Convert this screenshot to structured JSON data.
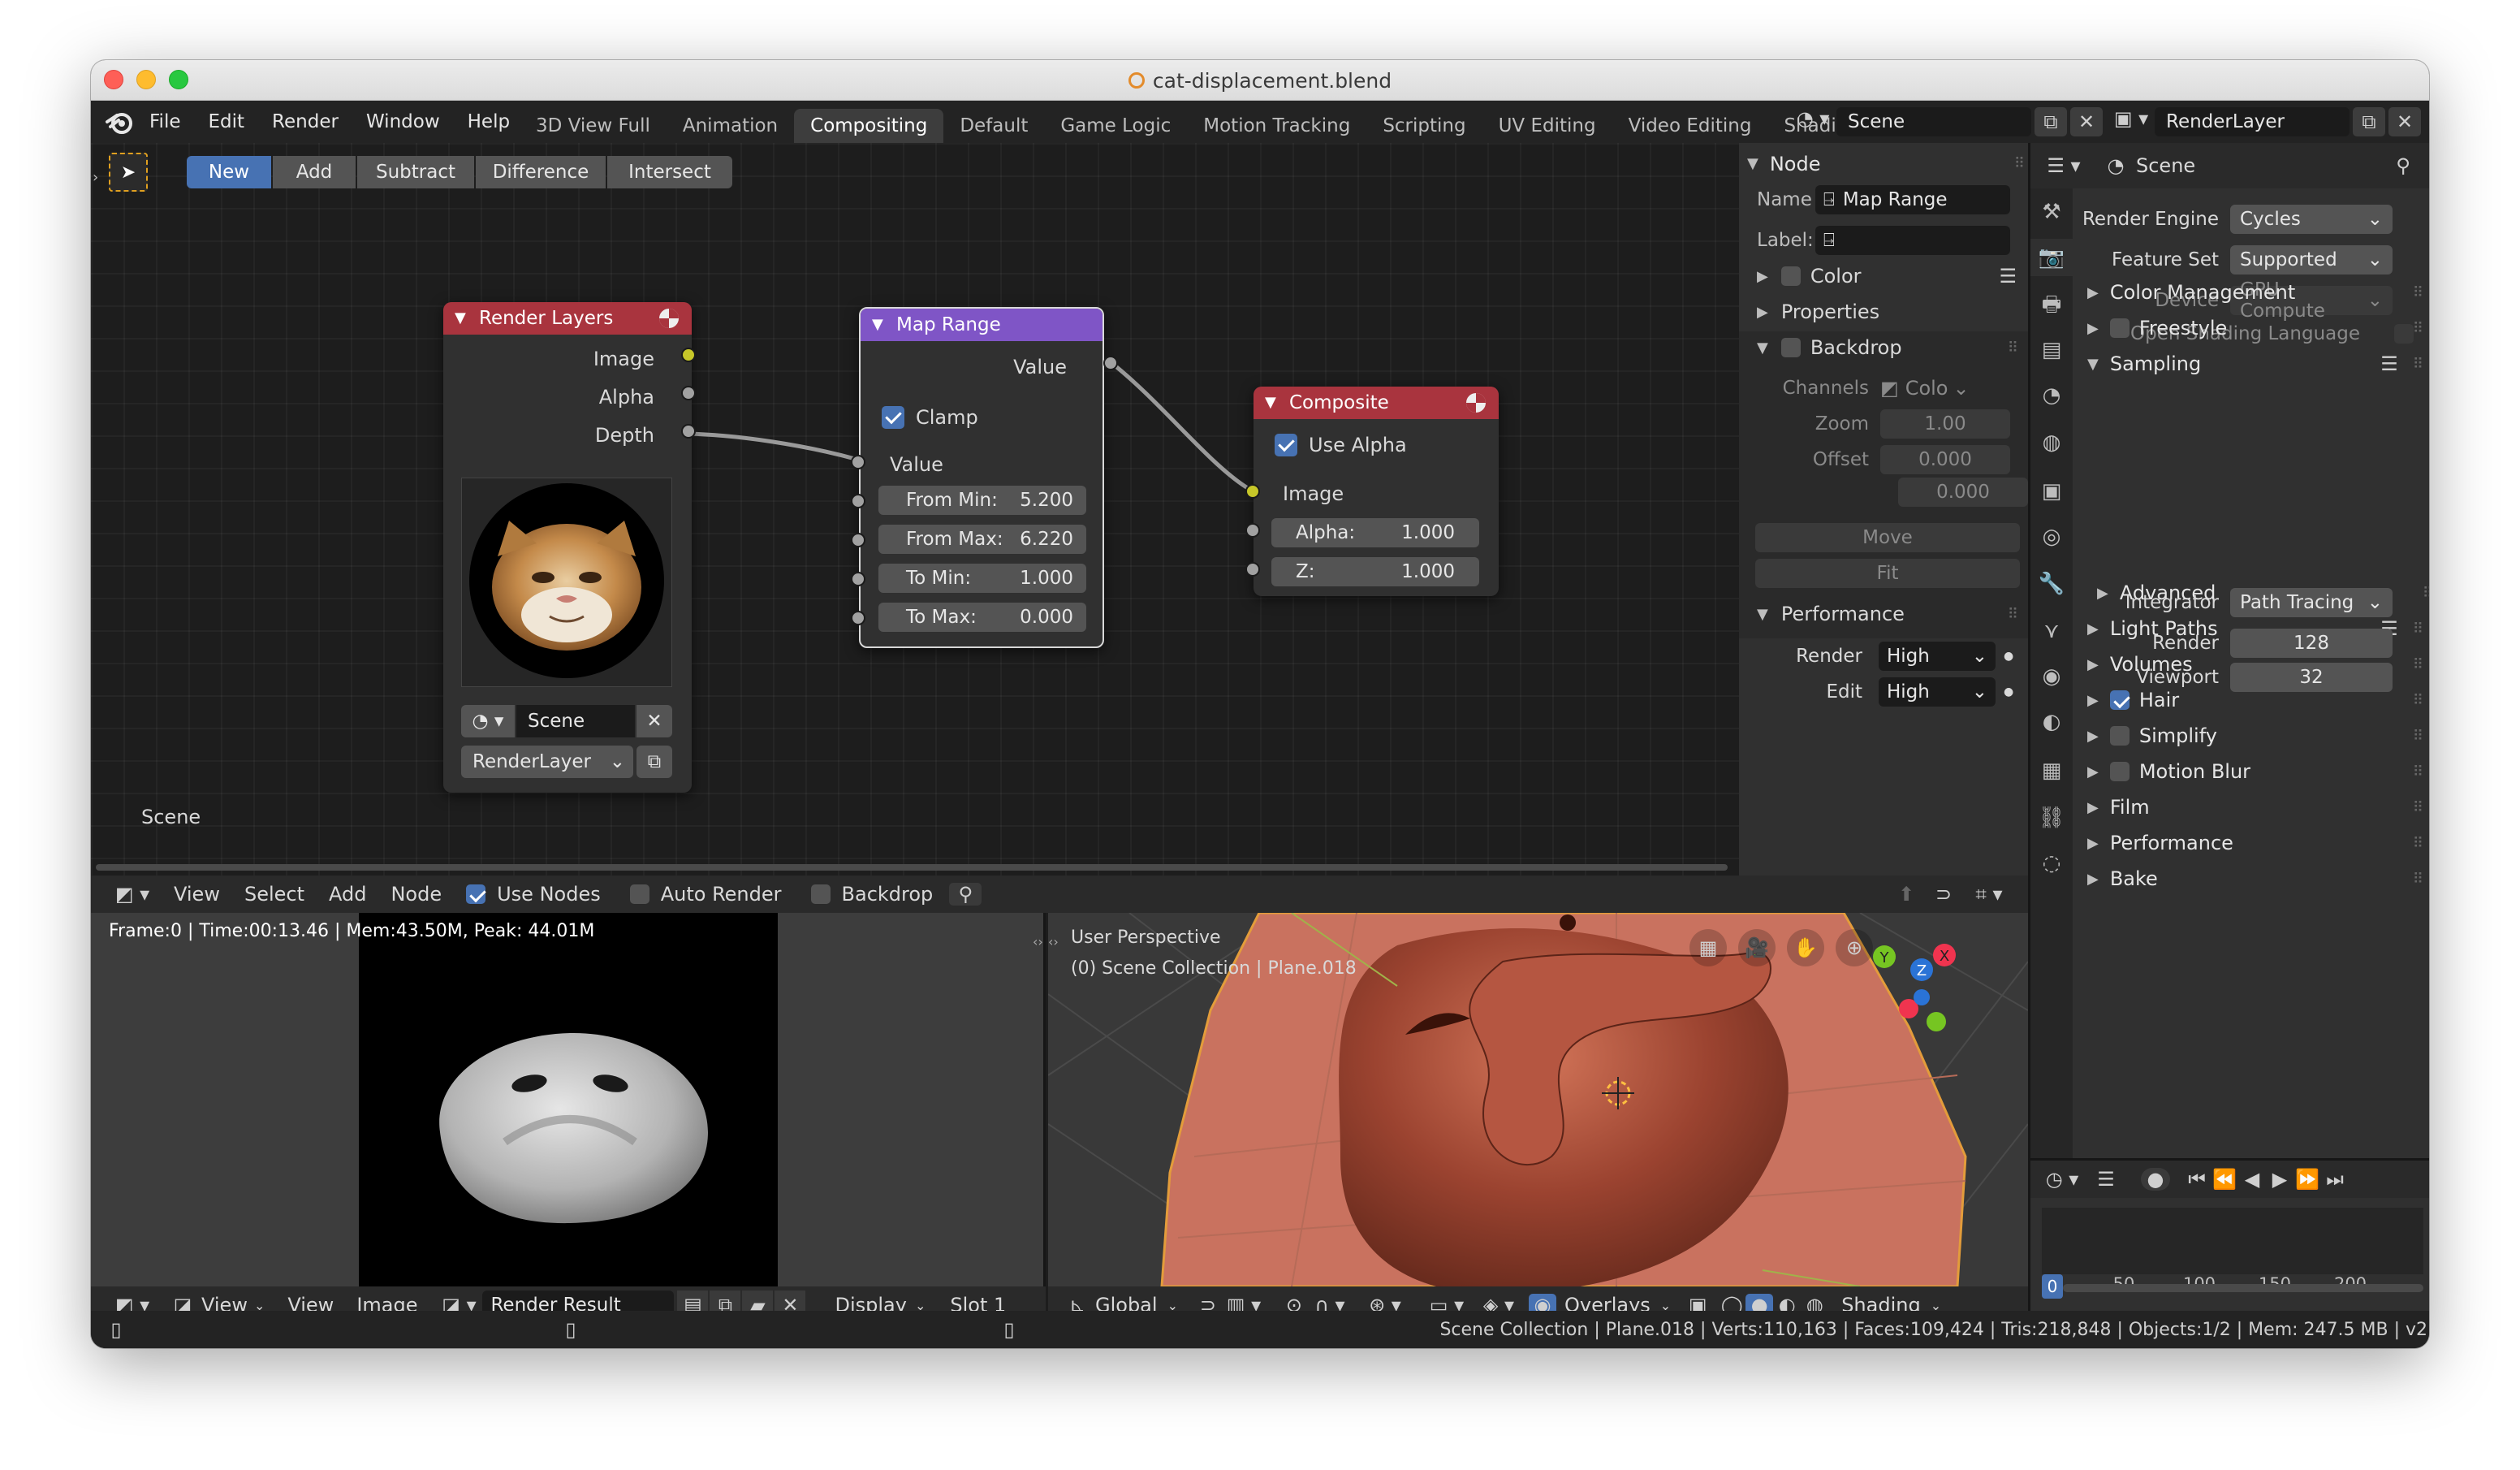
{
  "window": {
    "title": "cat-displacement.blend"
  },
  "menu": {
    "items": [
      "File",
      "Edit",
      "Render",
      "Window",
      "Help"
    ]
  },
  "workspaces": {
    "tabs": [
      "3D View Full",
      "Animation",
      "Compositing",
      "Default",
      "Game Logic",
      "Motion Tracking",
      "Scripting",
      "UV Editing",
      "Video Editing",
      "Shading"
    ],
    "active": "Compositing"
  },
  "scene_selector": {
    "value": "Scene"
  },
  "layer_selector": {
    "value": "RenderLayer"
  },
  "toolbar": {
    "new": "New",
    "add": "Add",
    "subtract": "Subtract",
    "difference": "Difference",
    "intersect": "Intersect"
  },
  "node_editor": {
    "scene_label": "Scene",
    "render_layers": {
      "title": "Render Layers",
      "outputs": [
        "Image",
        "Alpha",
        "Depth"
      ],
      "scene": "Scene",
      "layer": "RenderLayer"
    },
    "map_range": {
      "title": "Map Range",
      "output": "Value",
      "clamp": "Clamp",
      "input": "Value",
      "fields": [
        {
          "label": "From Min:",
          "value": "5.200"
        },
        {
          "label": "From Max:",
          "value": "6.220"
        },
        {
          "label": "To Min:",
          "value": "1.000"
        },
        {
          "label": "To Max:",
          "value": "0.000"
        }
      ]
    },
    "composite": {
      "title": "Composite",
      "use_alpha": "Use Alpha",
      "image": "Image",
      "fields": [
        {
          "label": "Alpha:",
          "value": "1.000"
        },
        {
          "label": "Z:",
          "value": "1.000"
        }
      ]
    }
  },
  "node_sidebar": {
    "node_header": "Node",
    "name_label": "Name",
    "name_value": "Map Range",
    "label_label": "Label:",
    "label_value": "",
    "color": "Color",
    "properties": "Properties",
    "backdrop": "Backdrop",
    "channels_label": "Channels",
    "channels_value": "Colo",
    "zoom_label": "Zoom",
    "zoom_value": "1.00",
    "offset_label": "Offset",
    "offset_x": "0.000",
    "offset_y": "0.000",
    "move": "Move",
    "fit": "Fit",
    "performance": "Performance",
    "render_label": "Render",
    "render_value": "High",
    "edit_label": "Edit",
    "edit_value": "High"
  },
  "editor_header": {
    "view": "View",
    "select": "Select",
    "add": "Add",
    "node": "Node",
    "use_nodes": "Use Nodes",
    "auto_render": "Auto Render",
    "backdrop": "Backdrop"
  },
  "properties": {
    "scene_name": "Scene",
    "render_engine_label": "Render Engine",
    "render_engine": "Cycles",
    "feature_set_label": "Feature Set",
    "feature_set": "Supported",
    "device_label": "Device",
    "device": "GPU Compute",
    "osl": "Open Shading Language",
    "color_management": "Color Management",
    "freestyle": "Freestyle",
    "sampling": "Sampling",
    "integrator_label": "Integrator",
    "integrator": "Path Tracing",
    "render_label": "Render",
    "render_samples": "128",
    "viewport_label": "Viewport",
    "viewport_samples": "32",
    "advanced": "Advanced",
    "light_paths": "Light Paths",
    "volumes": "Volumes",
    "hair": "Hair",
    "simplify": "Simplify",
    "motion_blur": "Motion Blur",
    "film": "Film",
    "performance": "Performance",
    "bake": "Bake"
  },
  "image_editor": {
    "info": "Frame:0 | Time:00:13.46 | Mem:43.50M, Peak: 44.01M",
    "view": "View",
    "view2": "View",
    "image": "Image",
    "image_name": "Render Result",
    "display": "Display",
    "slot": "Slot 1"
  },
  "viewport": {
    "line1": "User Perspective",
    "line2": "(0) Scene Collection | Plane.018",
    "transform": "Global",
    "overlays": "Overlays",
    "shading": "Shading",
    "gizmo": {
      "x": "X",
      "y": "Y",
      "z": "Z"
    }
  },
  "timeline": {
    "ticks": [
      "0",
      "50",
      "100",
      "150",
      "200"
    ],
    "current_frame": "0"
  },
  "statusbar": {
    "text": "Scene Collection | Plane.018 | Verts:110,163 | Faces:109,424 | Tris:218,848 | Objects:1/2 | Mem: 247.5 MB | v2"
  },
  "colors": {
    "accent": "#4772b3",
    "node_red": "#a9343e",
    "node_purple": "#7f55c6",
    "socket_yellow": "#c7c729",
    "socket_grey": "#a1a1a1"
  }
}
